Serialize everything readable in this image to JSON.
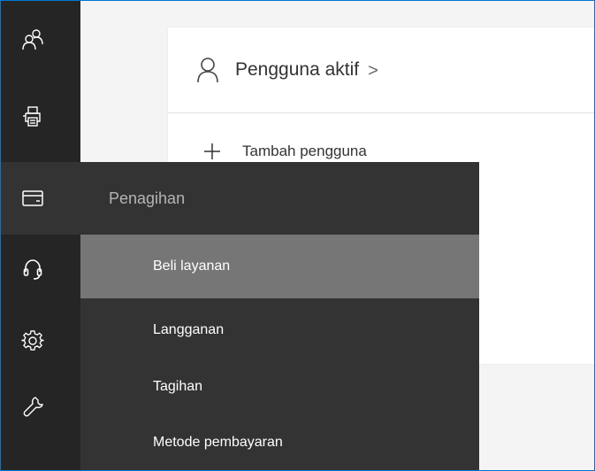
{
  "rail": {
    "items": [
      {
        "icon": "users-icon"
      },
      {
        "icon": "printer-icon"
      },
      {
        "icon": "credit-card-icon"
      },
      {
        "icon": "headset-icon"
      },
      {
        "icon": "gear-icon"
      },
      {
        "icon": "wrench-icon"
      }
    ],
    "active_icon": "credit-card-icon"
  },
  "card": {
    "title": "Pengguna aktif",
    "chevron": ">",
    "add_user_label": "Tambah pengguna"
  },
  "flyout": {
    "title": "Penagihan",
    "items": [
      {
        "label": "Beli layanan",
        "highlighted": true
      },
      {
        "label": "Langganan",
        "highlighted": false
      },
      {
        "label": "Tagihan",
        "highlighted": false
      },
      {
        "label": "Metode pembayaran",
        "highlighted": false
      }
    ]
  },
  "colors": {
    "rail_bg": "#252525",
    "flyout_bg": "#333333",
    "highlight_bg": "#767676",
    "frame_border": "#0078d4",
    "page_bg": "#f4f4f4"
  }
}
